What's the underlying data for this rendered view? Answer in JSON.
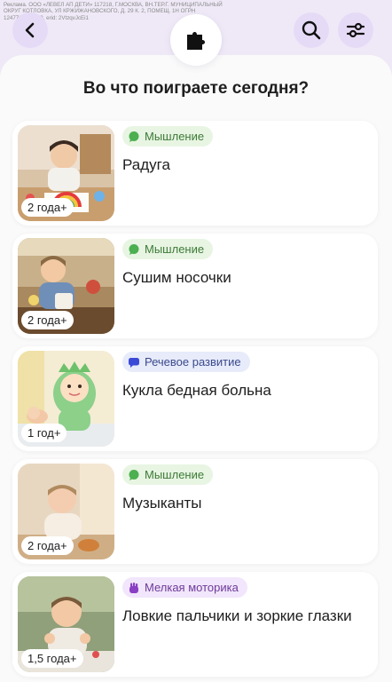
{
  "ad": {
    "text": "Реклама. ООО «ЛЕВЕЛ АП ДЕТИ» 117218, Г.МОСКВА, ВН.ТЕР.Г. МУНИЦИПАЛЬНЫЙ ОКРУГ КОТЛОВКА, УЛ КРЖИЖАНОВСКОГО, Д. 29 К. 2, ПОМЕЩ. 1Н ОГРН 1247700519648, erid: 2VtzqvJcEi1"
  },
  "header": {
    "back_icon": "chevron-left-icon",
    "center_icon": "puzzle-icon",
    "search_icon": "search-icon",
    "filter_icon": "sliders-icon"
  },
  "page": {
    "title": "Во что поиграете сегодня?"
  },
  "colors": {
    "accent": "#e6dbf6",
    "background": "#efe9f7",
    "tag_green": "#e8f5e3",
    "tag_blue": "#e7ebfa",
    "tag_purple": "#f1e6fb"
  },
  "games": [
    {
      "category": "Мышление",
      "category_icon": "chat-bubble-icon",
      "title": "Радуга",
      "age": "2 года+"
    },
    {
      "category": "Мышление",
      "category_icon": "chat-bubble-icon",
      "title": "Сушим носочки",
      "age": "2 года+"
    },
    {
      "category": "Речевое развитие",
      "category_icon": "speech-icon",
      "title": "Кукла бедная больна",
      "age": "1 год+"
    },
    {
      "category": "Мышление",
      "category_icon": "chat-bubble-icon",
      "title": "Музыканты",
      "age": "2 года+"
    },
    {
      "category": "Мелкая моторика",
      "category_icon": "hand-icon",
      "title": "Ловкие пальчики и зоркие глазки",
      "age": "1,5 года+"
    }
  ]
}
